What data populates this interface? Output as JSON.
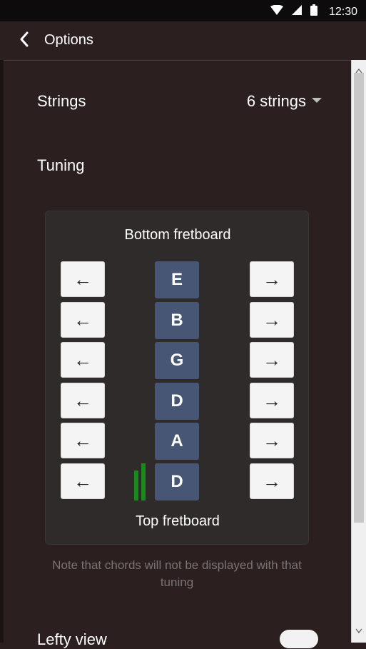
{
  "status_bar": {
    "time": "12:30"
  },
  "app_bar": {
    "title": "Options"
  },
  "strings": {
    "label": "Strings",
    "value": "6 strings"
  },
  "tuning": {
    "label": "Tuning",
    "top_label": "Bottom fretboard",
    "bottom_label": "Top fretboard",
    "notes": [
      "E",
      "B",
      "G",
      "D",
      "A",
      "D"
    ],
    "left_arrow": "←",
    "right_arrow": "→"
  },
  "note": "Note that chords will not be displayed with that tuning",
  "lefty": {
    "label": "Lefty view",
    "enabled": false
  },
  "colors": {
    "background": "#2b201f",
    "note_button": "#465674",
    "level": "#1a8a1a"
  }
}
